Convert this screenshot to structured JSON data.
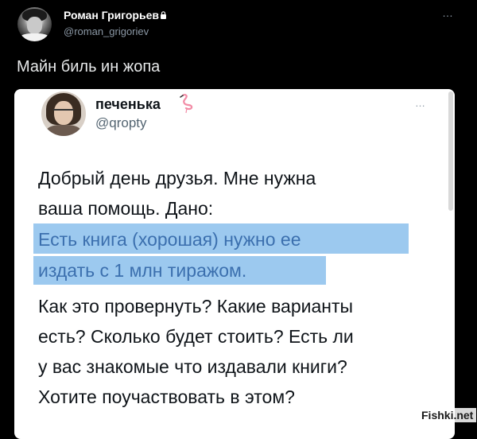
{
  "author": {
    "name": "Роман Григорьев",
    "handle": "@roman_grigoriev"
  },
  "tweet": {
    "text": "Майн биль ин жопа"
  },
  "quoted_tweet": {
    "name": "печенька",
    "handle": "@qropty",
    "lines": [
      "Добрый день друзья. Мне нужна",
      "ваша помощь. Дано:",
      "Есть книга (хорошая) нужно ее",
      "издать с 1 млн тиражом.",
      "Как это провернуть? Какие варианты",
      "есть? Сколько будет стоить? Есть ли",
      "у вас знакомые что издавали книги?",
      "Хотите поучаствовать в этом?"
    ]
  },
  "more_icon": "…",
  "watermark": "Fishki.net",
  "colors": {
    "background": "#000000",
    "card": "#ffffff",
    "highlight": "#9cc9ef",
    "handle": "#8b98a5"
  }
}
